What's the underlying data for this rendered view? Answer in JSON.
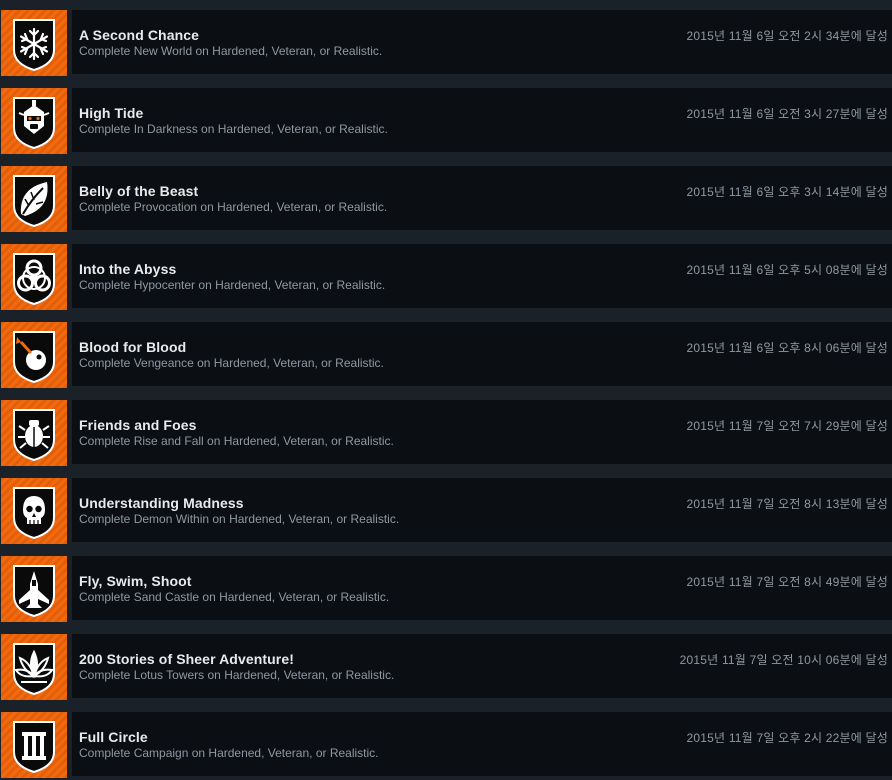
{
  "colors": {
    "background": "#1b2129",
    "row_panel": "#0b0f14",
    "icon_orange": "#f26a10",
    "title_text": "#e8eaec",
    "meta_text": "#8f98a0"
  },
  "achievements": [
    {
      "title": "A Second Chance",
      "description": "Complete New World on Hardened, Veteran, or Realistic.",
      "unlocked": "2015년 11월 6일 오전 2시 34분에 달성",
      "icon": "snowflake-icon"
    },
    {
      "title": "High Tide",
      "description": "Complete In Darkness on Hardened, Veteran, or Realistic.",
      "unlocked": "2015년 11월 6일 오전 3시 27분에 달성",
      "icon": "robot-head-icon"
    },
    {
      "title": "Belly of the Beast",
      "description": "Complete Provocation on Hardened, Veteran, or Realistic.",
      "unlocked": "2015년 11월 6일 오후 3시 14분에 달성",
      "icon": "leaf-icon"
    },
    {
      "title": "Into the Abyss",
      "description": "Complete Hypocenter on Hardened, Veteran, or Realistic.",
      "unlocked": "2015년 11월 6일 오후 5시 08분에 달성",
      "icon": "biohazard-icon"
    },
    {
      "title": "Blood for Blood",
      "description": "Complete Vengeance on Hardened, Veteran, or Realistic.",
      "unlocked": "2015년 11월 6일 오후 8시 06분에 달성",
      "icon": "bomb-icon"
    },
    {
      "title": "Friends and Foes",
      "description": "Complete Rise and Fall on Hardened, Veteran, or Realistic.",
      "unlocked": "2015년 11월 7일 오전 7시 29분에 달성",
      "icon": "scarab-icon"
    },
    {
      "title": "Understanding Madness",
      "description": "Complete Demon Within on Hardened, Veteran, or Realistic.",
      "unlocked": "2015년 11월 7일 오전 8시 13분에 달성",
      "icon": "skull-icon"
    },
    {
      "title": "Fly, Swim, Shoot",
      "description": "Complete Sand Castle on Hardened, Veteran, or Realistic.",
      "unlocked": "2015년 11월 7일 오전 8시 49분에 달성",
      "icon": "jet-icon"
    },
    {
      "title": "200 Stories of Sheer Adventure!",
      "description": "Complete Lotus Towers on Hardened, Veteran, or Realistic.",
      "unlocked": "2015년 11월 7일 오전 10시 06분에 달성",
      "icon": "lotus-icon"
    },
    {
      "title": "Full Circle",
      "description": "Complete Campaign on Hardened, Veteran, or Realistic.",
      "unlocked": "2015년 11월 7일 오후 2시 22분에 달성",
      "icon": "roman-three-icon"
    }
  ]
}
